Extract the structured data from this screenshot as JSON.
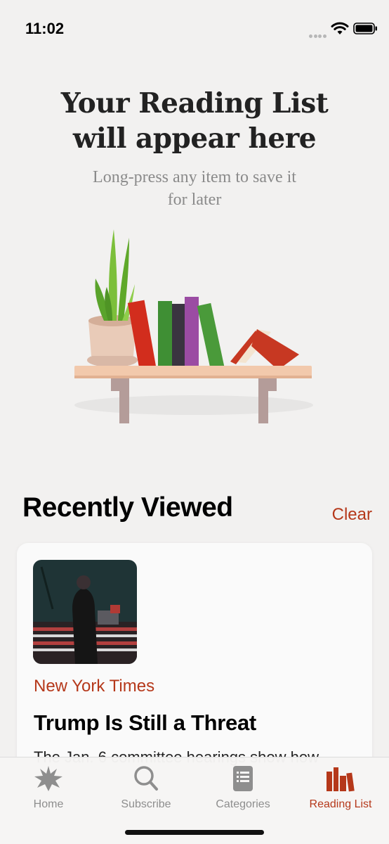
{
  "status_bar": {
    "time": "11:02",
    "icons": [
      "signal-icon",
      "wifi-icon",
      "battery-icon"
    ]
  },
  "empty_state": {
    "title_line1": "Your Reading List",
    "title_line2": "will appear here",
    "subtitle_line1": "Long-press any item to save it",
    "subtitle_line2": "for later",
    "illustration": "bookshelf-with-plant-illustration"
  },
  "recently_viewed": {
    "title": "Recently Viewed",
    "clear_label": "Clear",
    "articles": [
      {
        "source": "New York Times",
        "title": "Trump Is Still a Threat",
        "snippet": "The Jan. 6 committee hearings show how"
      }
    ]
  },
  "tab_bar": {
    "items": [
      {
        "label": "Home",
        "icon": "home-star-icon",
        "active": false
      },
      {
        "label": "Subscribe",
        "icon": "search-icon",
        "active": false
      },
      {
        "label": "Categories",
        "icon": "categories-list-icon",
        "active": false
      },
      {
        "label": "Reading List",
        "icon": "reading-list-books-icon",
        "active": true
      }
    ]
  },
  "colors": {
    "accent": "#b5381a",
    "background": "#f2f1f0",
    "inactive_tab": "#8e8e8e"
  }
}
